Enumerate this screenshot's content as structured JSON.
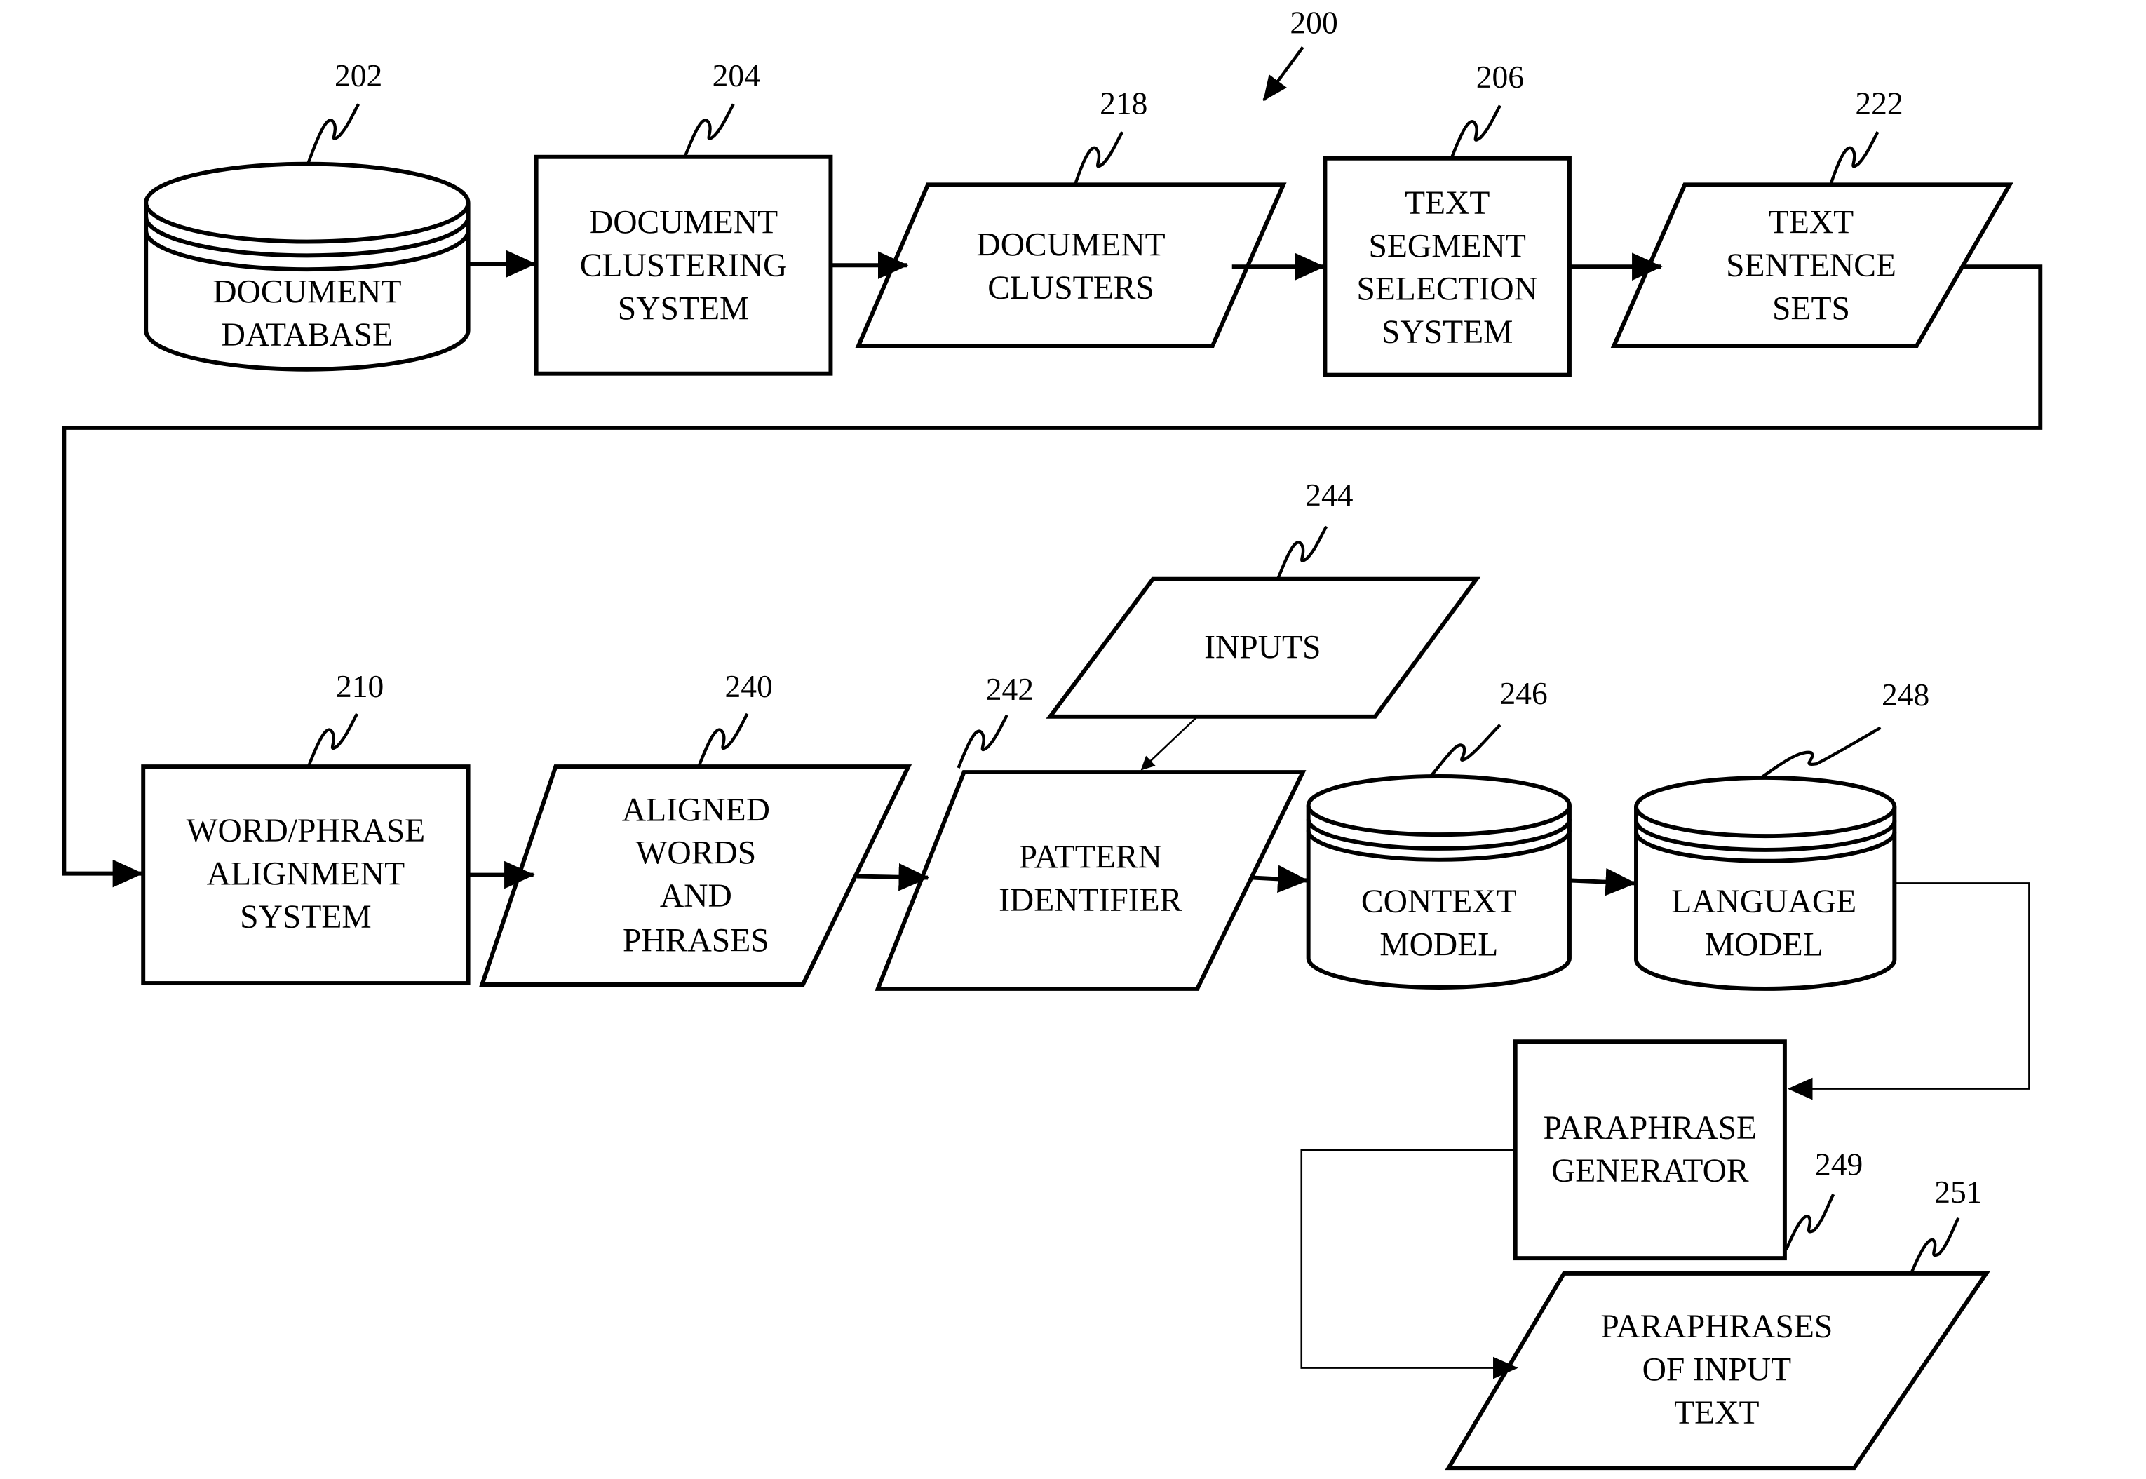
{
  "figure": {
    "reference": "200",
    "nodes": {
      "document_database": {
        "ref": "202",
        "lines": [
          "DOCUMENT",
          "DATABASE"
        ],
        "shape": "database"
      },
      "document_clustering_system": {
        "ref": "204",
        "lines": [
          "DOCUMENT",
          "CLUSTERING",
          "SYSTEM"
        ],
        "shape": "process"
      },
      "document_clusters": {
        "ref": "218",
        "lines": [
          "DOCUMENT",
          "CLUSTERS"
        ],
        "shape": "data"
      },
      "text_segment_selection_system": {
        "ref": "206",
        "lines": [
          "TEXT",
          "SEGMENT",
          "SELECTION",
          "SYSTEM"
        ],
        "shape": "process"
      },
      "text_sentence_sets": {
        "ref": "222",
        "lines": [
          "TEXT",
          "SENTENCE",
          "SETS"
        ],
        "shape": "data"
      },
      "word_phrase_alignment_system": {
        "ref": "210",
        "lines": [
          "WORD/PHRASE",
          "ALIGNMENT",
          "SYSTEM"
        ],
        "shape": "process"
      },
      "aligned_words_and_phrases": {
        "ref": "240",
        "lines": [
          "ALIGNED",
          "WORDS",
          "AND",
          "PHRASES"
        ],
        "shape": "data"
      },
      "pattern_identifier": {
        "ref": "242",
        "lines": [
          "PATTERN",
          "IDENTIFIER"
        ],
        "shape": "data"
      },
      "inputs": {
        "ref": "244",
        "lines": [
          "INPUTS"
        ],
        "shape": "data"
      },
      "context_model": {
        "ref": "246",
        "lines": [
          "CONTEXT",
          "MODEL"
        ],
        "shape": "database"
      },
      "language_model": {
        "ref": "248",
        "lines": [
          "LANGUAGE",
          "MODEL"
        ],
        "shape": "database"
      },
      "paraphrase_generator": {
        "ref": "249",
        "lines": [
          "PARAPHRASE",
          "GENERATOR"
        ],
        "shape": "process"
      },
      "paraphrases_of_input_text": {
        "ref": "251",
        "lines": [
          "PARAPHRASES",
          "OF INPUT",
          "TEXT"
        ],
        "shape": "data"
      }
    },
    "edges": [
      [
        "document_database",
        "document_clustering_system"
      ],
      [
        "document_clustering_system",
        "document_clusters"
      ],
      [
        "document_clusters",
        "text_segment_selection_system"
      ],
      [
        "text_segment_selection_system",
        "text_sentence_sets"
      ],
      [
        "text_sentence_sets",
        "word_phrase_alignment_system"
      ],
      [
        "word_phrase_alignment_system",
        "aligned_words_and_phrases"
      ],
      [
        "aligned_words_and_phrases",
        "pattern_identifier"
      ],
      [
        "inputs",
        "pattern_identifier"
      ],
      [
        "pattern_identifier",
        "context_model"
      ],
      [
        "context_model",
        "language_model"
      ],
      [
        "language_model",
        "paraphrase_generator"
      ],
      [
        "paraphrase_generator",
        "paraphrases_of_input_text"
      ]
    ]
  }
}
